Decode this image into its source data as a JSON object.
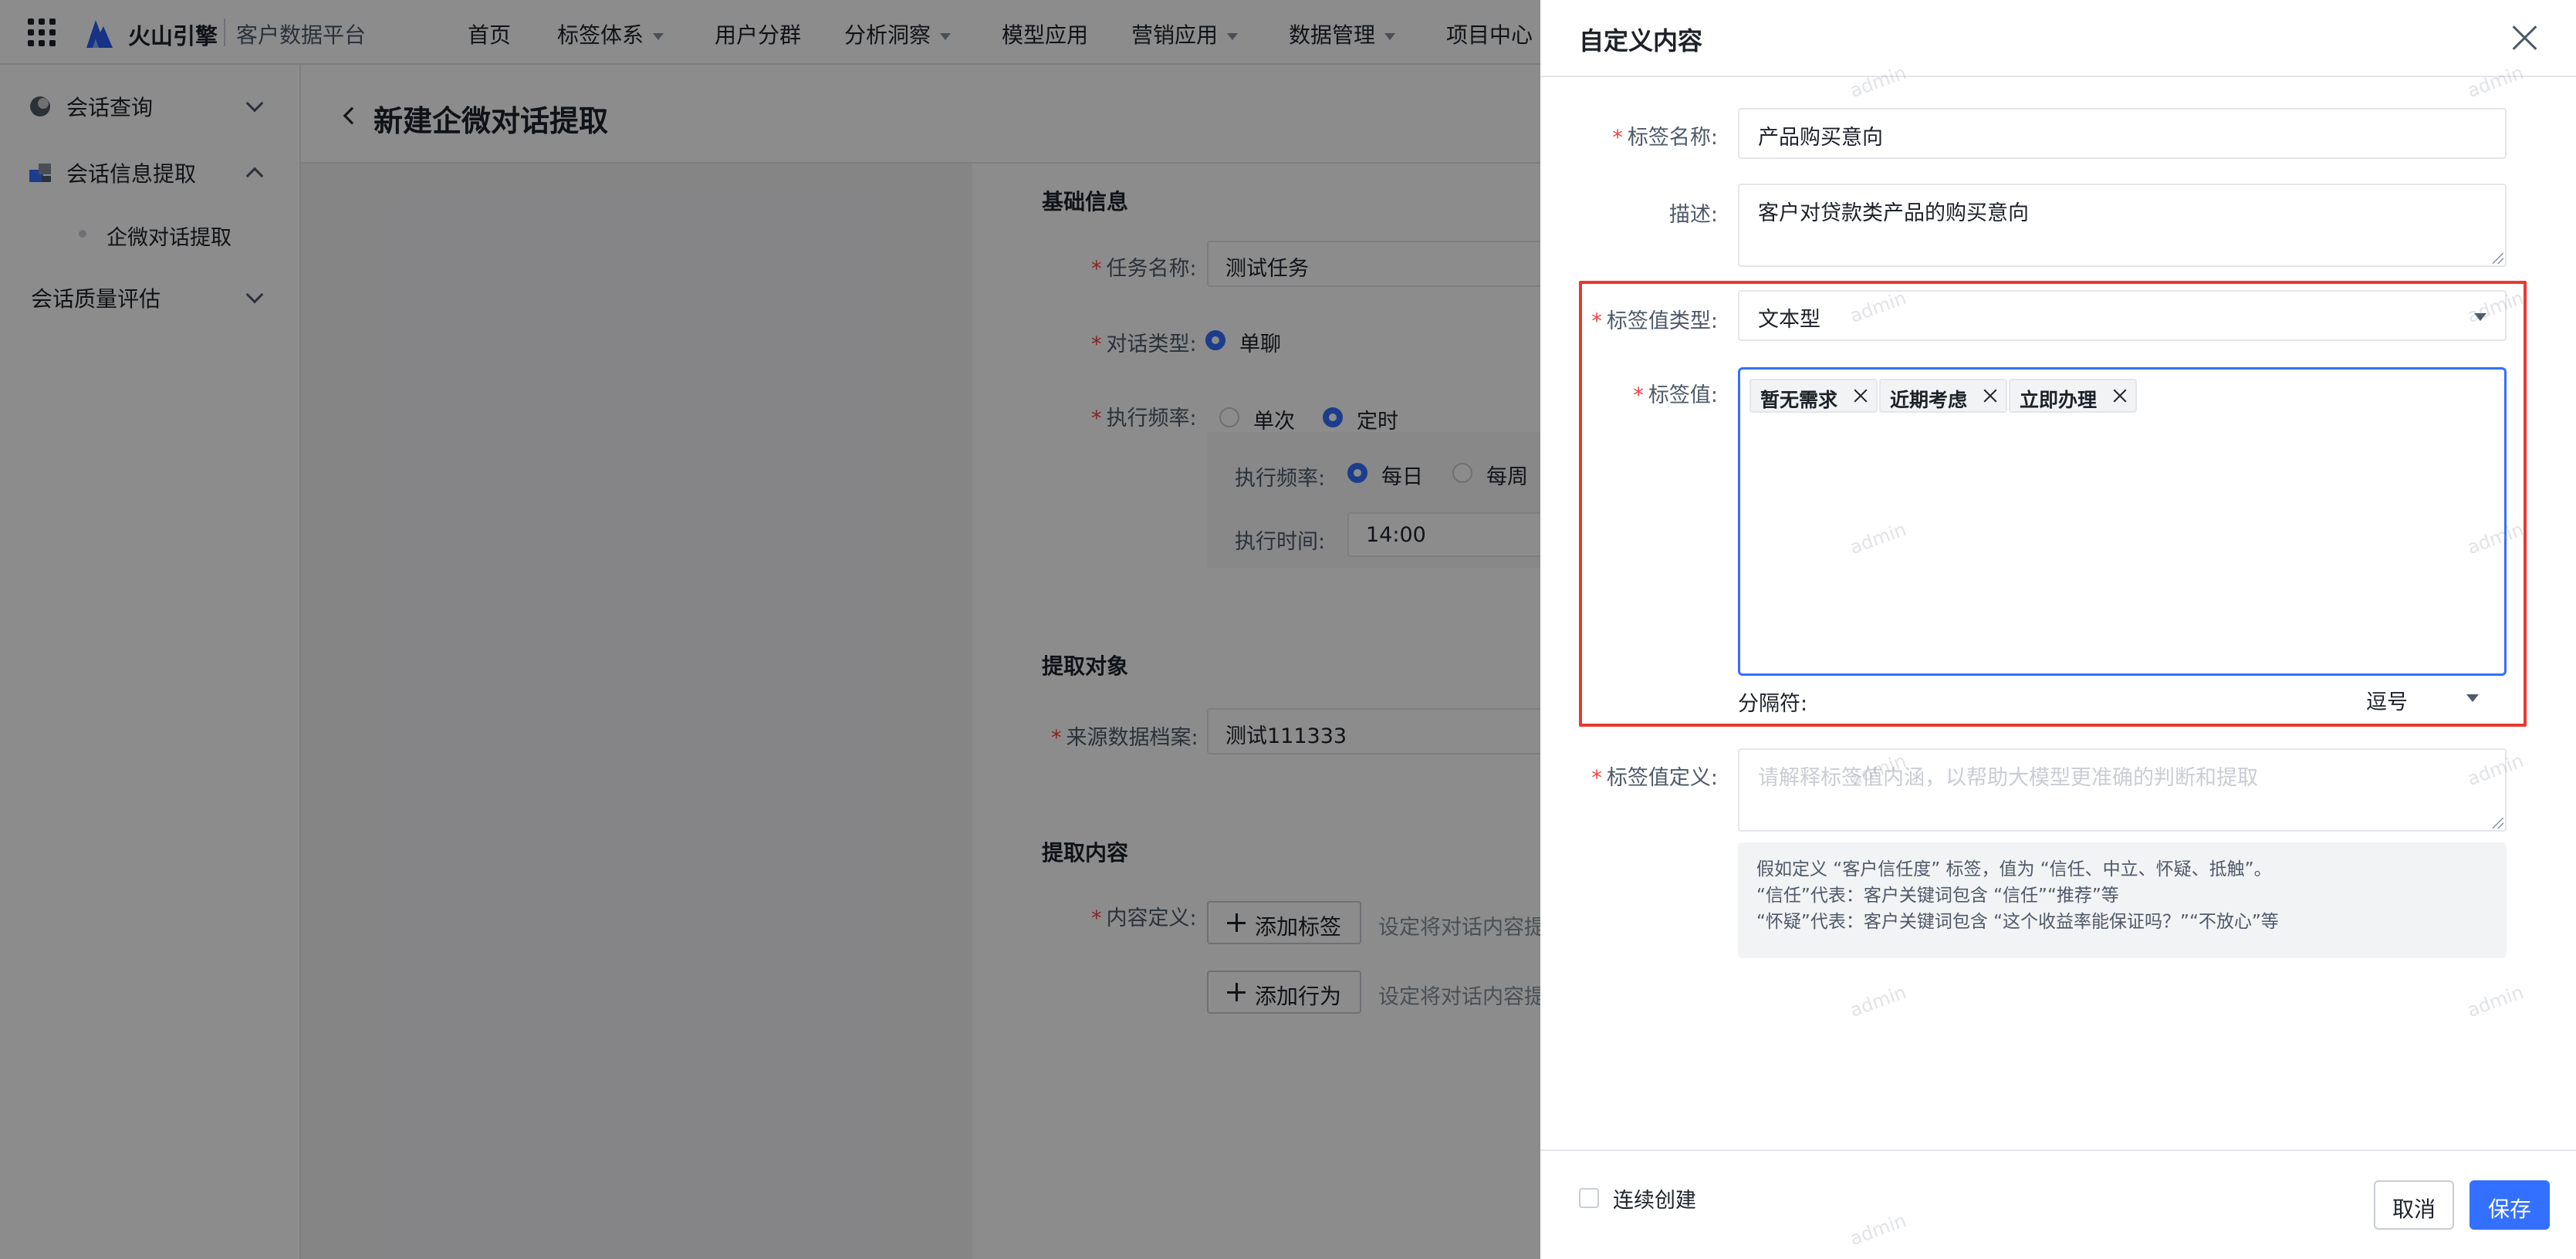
{
  "topbar": {
    "brand": "火山引擎",
    "platform": "客户数据平台",
    "nav": [
      {
        "label": "首页",
        "has_caret": false
      },
      {
        "label": "标签体系",
        "has_caret": true
      },
      {
        "label": "用户分群",
        "has_caret": false
      },
      {
        "label": "分析洞察",
        "has_caret": true
      },
      {
        "label": "模型应用",
        "has_caret": false
      },
      {
        "label": "营销应用",
        "has_caret": true
      },
      {
        "label": "数据管理",
        "has_caret": true
      },
      {
        "label": "项目中心",
        "has_caret": false
      }
    ]
  },
  "sidebar": {
    "items": [
      {
        "label": "会话查询",
        "icon": "chat-query-icon",
        "expanded": false
      },
      {
        "label": "会话信息提取",
        "icon": "info-extract-icon",
        "expanded": true
      },
      {
        "label": "企微对话提取"
      },
      {
        "label": "会话质量评估",
        "expanded": false
      }
    ]
  },
  "page": {
    "title": "新建企微对话提取",
    "basic_section": "基础信息",
    "task_name_label": "任务名称:",
    "task_name_value": "测试任务",
    "dialog_type_label": "对话类型:",
    "dialog_type_option": "单聊",
    "freq_label": "执行频率:",
    "freq_once": "单次",
    "freq_scheduled": "定时",
    "sub_freq_label": "执行频率:",
    "sub_freq_daily": "每日",
    "sub_freq_weekly": "每周",
    "exec_time_label": "执行时间:",
    "exec_time_value": "14:00",
    "target_section": "提取对象",
    "source_label": "来源数据档案:",
    "source_value": "测试111333",
    "content_section": "提取内容",
    "content_label": "内容定义:",
    "add_tag_button": "添加标签",
    "add_behavior_button": "添加行为",
    "hint_text": "设定将对话内容提"
  },
  "drawer": {
    "title": "自定义内容",
    "tag_name_label": "标签名称:",
    "tag_name_value": "产品购买意向",
    "desc_label": "描述:",
    "desc_value": "客户对贷款类产品的购买意向",
    "value_type_label": "标签值类型:",
    "value_type_value": "文本型",
    "values_label": "标签值:",
    "values": [
      "暂无需求",
      "近期考虑",
      "立即办理"
    ],
    "separator_label": "分隔符:",
    "separator_value": "逗号",
    "value_def_label": "标签值定义:",
    "value_def_placeholder": "请解释标签值内涵，以帮助大模型更准确的判断和提取",
    "example_lines": [
      "假如定义 “客户信任度” 标签，值为 “信任、中立、怀疑、抵触”。",
      "“信任”代表：客户关键词包含 “信任”“推荐”等",
      "“怀疑”代表：客户关键词包含 “这个收益率能保证吗？”“不放心”等"
    ],
    "continuous_create": "连续创建",
    "cancel_button": "取消",
    "save_button": "保存"
  },
  "watermark": "admin",
  "colors": {
    "primary": "#3370ff",
    "highlight": "#e8392e",
    "required": "#f53f3f"
  }
}
